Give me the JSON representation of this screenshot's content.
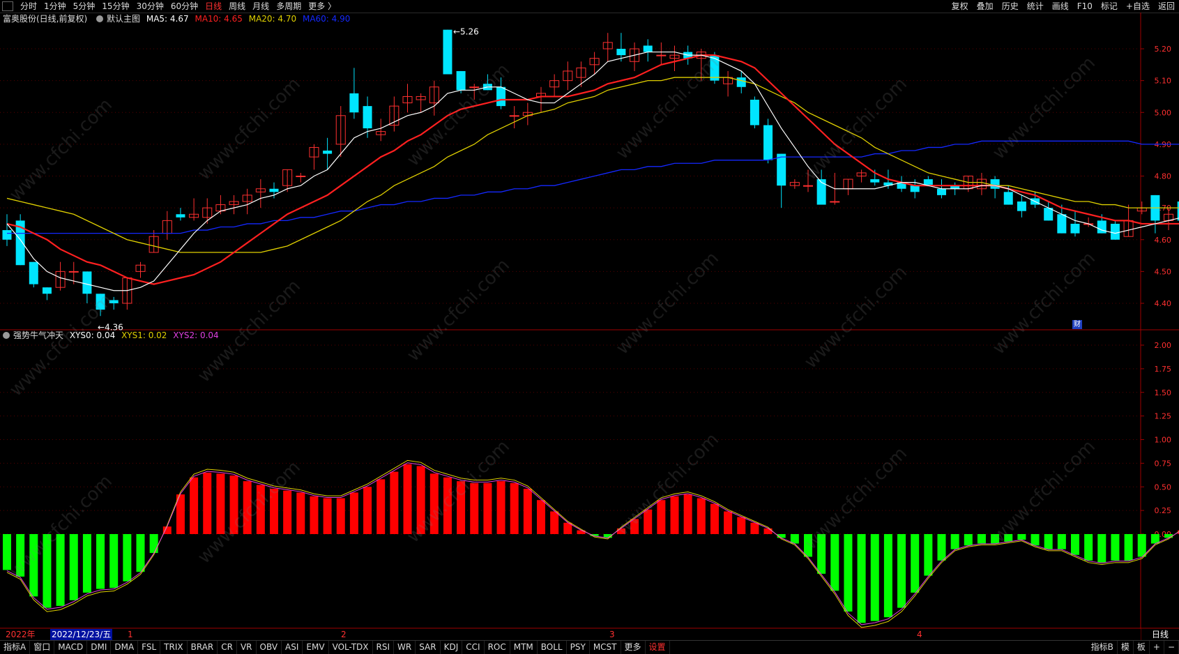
{
  "topbar": {
    "tabs": [
      "分时",
      "1分钟",
      "5分钟",
      "15分钟",
      "30分钟",
      "60分钟",
      "日线",
      "周线",
      "月线",
      "多周期",
      "更多 〉"
    ],
    "active_tab": "日线",
    "right_tools": [
      "复权",
      "叠加",
      "历史",
      "统计",
      "画线",
      "F10",
      "标记",
      "+自选",
      "返回"
    ]
  },
  "main_legend": {
    "stock": "富奥股份(日线,前复权)",
    "template": "默认主图",
    "ma5": "MA5: 4.67",
    "ma10": "MA10: 4.65",
    "ma20": "MA20: 4.70",
    "ma60": "MA60: 4.90"
  },
  "indicator_legend": {
    "name": "强势牛气冲天",
    "xys0": "XYS0: 0.04",
    "xys1": "XYS1: 0.02",
    "xys2": "XYS2: 0.04"
  },
  "annotations": {
    "high": "5.26",
    "low": "←4.36",
    "cai": "财"
  },
  "date_axis": {
    "year": "2022年",
    "cursor_date": "2022/12/23/五",
    "months": [
      "1",
      "2",
      "3",
      "4"
    ]
  },
  "right_label": "日线",
  "bottombar": {
    "left": [
      "指标A",
      "窗口",
      "MACD",
      "DMI",
      "DMA",
      "FSL",
      "TRIX",
      "BRAR",
      "CR",
      "VR",
      "OBV",
      "ASI",
      "EMV",
      "VOL-TDX",
      "RSI",
      "WR",
      "SAR",
      "KDJ",
      "CCI",
      "ROC",
      "MTM",
      "BOLL",
      "PSY",
      "MCST",
      "更多",
      "设置"
    ],
    "active": "设置",
    "right": [
      "指标B",
      "模",
      "板",
      "+",
      "−"
    ]
  },
  "watermark": "www.cfchi.com",
  "colors": {
    "up": "#ff3030",
    "down": "#00e5ff",
    "ma5": "#ffffff",
    "ma10": "#ff2020",
    "ma20": "#e0d000",
    "ma60": "#1428ff",
    "bar_up": "#ff0000",
    "bar_down": "#00ff00"
  },
  "chart_data": [
    {
      "type": "candlestick",
      "yticks": [
        "5.20",
        "5.10",
        "5.00",
        "4.90",
        "4.80",
        "4.70",
        "4.60",
        "4.50",
        "4.40"
      ],
      "ohlc": [
        [
          4.63,
          4.68,
          4.58,
          4.6
        ],
        [
          4.66,
          4.68,
          4.52,
          4.52
        ],
        [
          4.53,
          4.53,
          4.45,
          4.46
        ],
        [
          4.45,
          4.45,
          4.41,
          4.43
        ],
        [
          4.45,
          4.53,
          4.44,
          4.5
        ],
        [
          4.5,
          4.53,
          4.46,
          4.5
        ],
        [
          4.5,
          4.5,
          4.4,
          4.43
        ],
        [
          4.43,
          4.43,
          4.36,
          4.38
        ],
        [
          4.41,
          4.42,
          4.38,
          4.4
        ],
        [
          4.4,
          4.48,
          4.38,
          4.48
        ],
        [
          4.5,
          4.53,
          4.48,
          4.52
        ],
        [
          4.56,
          4.63,
          4.56,
          4.61
        ],
        [
          4.62,
          4.69,
          4.6,
          4.66
        ],
        [
          4.68,
          4.7,
          4.66,
          4.67
        ],
        [
          4.67,
          4.73,
          4.66,
          4.68
        ],
        [
          4.67,
          4.73,
          4.65,
          4.7
        ],
        [
          4.69,
          4.74,
          4.68,
          4.71
        ],
        [
          4.71,
          4.74,
          4.68,
          4.72
        ],
        [
          4.72,
          4.76,
          4.68,
          4.74
        ],
        [
          4.75,
          4.79,
          4.7,
          4.76
        ],
        [
          4.76,
          4.78,
          4.73,
          4.75
        ],
        [
          4.77,
          4.82,
          4.75,
          4.82
        ],
        [
          4.8,
          4.81,
          4.78,
          4.8
        ],
        [
          4.86,
          4.9,
          4.82,
          4.89
        ],
        [
          4.88,
          4.92,
          4.82,
          4.87
        ],
        [
          4.9,
          5.02,
          4.86,
          4.99
        ],
        [
          5.06,
          5.14,
          4.98,
          5.0
        ],
        [
          5.02,
          5.05,
          4.92,
          4.95
        ],
        [
          4.93,
          4.98,
          4.91,
          4.94
        ],
        [
          4.96,
          5.05,
          4.94,
          5.02
        ],
        [
          5.03,
          5.09,
          5.0,
          5.05
        ],
        [
          5.04,
          5.06,
          5.0,
          5.05
        ],
        [
          5.03,
          5.1,
          4.99,
          5.08
        ],
        [
          5.26,
          5.26,
          5.12,
          5.12
        ],
        [
          5.13,
          5.13,
          5.06,
          5.07
        ],
        [
          5.08,
          5.09,
          5.04,
          5.08
        ],
        [
          5.09,
          5.12,
          5.07,
          5.07
        ],
        [
          5.08,
          5.11,
          5.01,
          5.02
        ],
        [
          4.99,
          5.02,
          4.95,
          4.99
        ],
        [
          4.99,
          5.03,
          4.96,
          5.0
        ],
        [
          5.05,
          5.08,
          5.0,
          5.06
        ],
        [
          5.08,
          5.12,
          5.05,
          5.1
        ],
        [
          5.1,
          5.16,
          5.07,
          5.13
        ],
        [
          5.11,
          5.16,
          5.08,
          5.14
        ],
        [
          5.15,
          5.19,
          5.12,
          5.17
        ],
        [
          5.2,
          5.25,
          5.16,
          5.22
        ],
        [
          5.2,
          5.25,
          5.16,
          5.18
        ],
        [
          5.16,
          5.22,
          5.13,
          5.2
        ],
        [
          5.21,
          5.23,
          5.16,
          5.19
        ],
        [
          5.18,
          5.22,
          5.15,
          5.18
        ],
        [
          5.17,
          5.21,
          5.13,
          5.18
        ],
        [
          5.19,
          5.21,
          5.15,
          5.17
        ],
        [
          5.17,
          5.2,
          5.1,
          5.19
        ],
        [
          5.18,
          5.19,
          5.09,
          5.1
        ],
        [
          5.09,
          5.13,
          5.05,
          5.11
        ],
        [
          5.11,
          5.13,
          5.06,
          5.08
        ],
        [
          5.04,
          5.05,
          4.95,
          4.96
        ],
        [
          4.96,
          4.98,
          4.84,
          4.85
        ],
        [
          4.87,
          4.87,
          4.7,
          4.77
        ],
        [
          4.77,
          4.79,
          4.76,
          4.78
        ],
        [
          4.77,
          4.82,
          4.75,
          4.77
        ],
        [
          4.79,
          4.82,
          4.72,
          4.71
        ],
        [
          4.72,
          4.81,
          4.71,
          4.72
        ],
        [
          4.76,
          4.79,
          4.74,
          4.79
        ],
        [
          4.8,
          4.82,
          4.78,
          4.81
        ],
        [
          4.79,
          4.82,
          4.77,
          4.78
        ],
        [
          4.78,
          4.82,
          4.76,
          4.77
        ],
        [
          4.78,
          4.8,
          4.75,
          4.76
        ],
        [
          4.77,
          4.79,
          4.73,
          4.75
        ],
        [
          4.79,
          4.8,
          4.77,
          4.77
        ],
        [
          4.76,
          4.79,
          4.73,
          4.74
        ],
        [
          4.77,
          4.78,
          4.74,
          4.76
        ],
        [
          4.76,
          4.8,
          4.75,
          4.8
        ],
        [
          4.76,
          4.81,
          4.74,
          4.79
        ],
        [
          4.79,
          4.8,
          4.73,
          4.76
        ],
        [
          4.75,
          4.77,
          4.71,
          4.71
        ],
        [
          4.72,
          4.74,
          4.67,
          4.69
        ],
        [
          4.73,
          4.75,
          4.7,
          4.71
        ],
        [
          4.7,
          4.72,
          4.66,
          4.66
        ],
        [
          4.68,
          4.71,
          4.62,
          4.62
        ],
        [
          4.65,
          4.69,
          4.61,
          4.62
        ],
        [
          4.65,
          4.67,
          4.64,
          4.65
        ],
        [
          4.66,
          4.68,
          4.62,
          4.62
        ],
        [
          4.65,
          4.66,
          4.6,
          4.6
        ],
        [
          4.61,
          4.71,
          4.61,
          4.66
        ],
        [
          4.69,
          4.72,
          4.68,
          4.7
        ],
        [
          4.74,
          4.74,
          4.62,
          4.66
        ],
        [
          4.66,
          4.7,
          4.63,
          4.68
        ],
        [
          4.72,
          4.78,
          4.66,
          4.66
        ]
      ],
      "ma5": [
        4.65,
        4.6,
        4.54,
        4.5,
        4.48,
        4.47,
        4.46,
        4.45,
        4.44,
        4.44,
        4.45,
        4.47,
        4.52,
        4.57,
        4.62,
        4.66,
        4.69,
        4.7,
        4.71,
        4.73,
        4.74,
        4.76,
        4.77,
        4.8,
        4.82,
        4.87,
        4.92,
        4.94,
        4.95,
        4.97,
        4.99,
        5.0,
        5.02,
        5.06,
        5.07,
        5.07,
        5.08,
        5.08,
        5.06,
        5.04,
        5.03,
        5.03,
        5.06,
        5.09,
        5.12,
        5.16,
        5.17,
        5.18,
        5.19,
        5.19,
        5.19,
        5.18,
        5.18,
        5.17,
        5.15,
        5.13,
        5.09,
        5.02,
        4.95,
        4.89,
        4.83,
        4.78,
        4.76,
        4.76,
        4.76,
        4.76,
        4.77,
        4.78,
        4.78,
        4.77,
        4.76,
        4.76,
        4.76,
        4.77,
        4.77,
        4.76,
        4.74,
        4.72,
        4.7,
        4.68,
        4.66,
        4.65,
        4.63,
        4.62,
        4.63,
        4.64,
        4.65,
        4.66,
        4.67
      ],
      "ma10": [
        4.65,
        4.64,
        4.62,
        4.6,
        4.57,
        4.55,
        4.53,
        4.52,
        4.5,
        4.48,
        4.47,
        4.46,
        4.47,
        4.48,
        4.49,
        4.51,
        4.53,
        4.56,
        4.59,
        4.62,
        4.65,
        4.68,
        4.7,
        4.72,
        4.74,
        4.77,
        4.8,
        4.83,
        4.86,
        4.88,
        4.91,
        4.93,
        4.96,
        4.99,
        5.01,
        5.02,
        5.03,
        5.04,
        5.04,
        5.04,
        5.05,
        5.05,
        5.05,
        5.06,
        5.07,
        5.09,
        5.1,
        5.11,
        5.13,
        5.15,
        5.16,
        5.17,
        5.18,
        5.18,
        5.17,
        5.16,
        5.14,
        5.1,
        5.06,
        5.02,
        4.98,
        4.94,
        4.9,
        4.87,
        4.84,
        4.81,
        4.79,
        4.78,
        4.77,
        4.77,
        4.77,
        4.77,
        4.77,
        4.77,
        4.77,
        4.76,
        4.75,
        4.74,
        4.72,
        4.7,
        4.69,
        4.68,
        4.67,
        4.66,
        4.66,
        4.65,
        4.65,
        4.65,
        4.65
      ],
      "ma20": [
        4.73,
        4.72,
        4.71,
        4.7,
        4.69,
        4.68,
        4.66,
        4.64,
        4.62,
        4.6,
        4.59,
        4.58,
        4.57,
        4.56,
        4.56,
        4.56,
        4.56,
        4.56,
        4.56,
        4.56,
        4.57,
        4.58,
        4.6,
        4.62,
        4.64,
        4.66,
        4.69,
        4.72,
        4.74,
        4.77,
        4.79,
        4.81,
        4.83,
        4.86,
        4.88,
        4.9,
        4.93,
        4.95,
        4.97,
        4.99,
        5.0,
        5.01,
        5.03,
        5.04,
        5.05,
        5.07,
        5.08,
        5.09,
        5.1,
        5.1,
        5.11,
        5.11,
        5.11,
        5.11,
        5.11,
        5.1,
        5.09,
        5.07,
        5.05,
        5.03,
        5.0,
        4.98,
        4.96,
        4.94,
        4.92,
        4.89,
        4.87,
        4.85,
        4.83,
        4.81,
        4.8,
        4.79,
        4.78,
        4.78,
        4.77,
        4.77,
        4.76,
        4.75,
        4.74,
        4.73,
        4.72,
        4.72,
        4.71,
        4.71,
        4.7,
        4.7,
        4.7,
        4.7,
        4.7
      ],
      "ma60": [
        4.62,
        4.62,
        4.62,
        4.62,
        4.62,
        4.62,
        4.62,
        4.62,
        4.62,
        4.62,
        4.62,
        4.62,
        4.62,
        4.62,
        4.63,
        4.63,
        4.64,
        4.64,
        4.65,
        4.65,
        4.66,
        4.66,
        4.67,
        4.67,
        4.68,
        4.69,
        4.69,
        4.7,
        4.71,
        4.71,
        4.72,
        4.72,
        4.73,
        4.73,
        4.74,
        4.74,
        4.75,
        4.75,
        4.76,
        4.76,
        4.77,
        4.77,
        4.78,
        4.79,
        4.8,
        4.81,
        4.82,
        4.82,
        4.83,
        4.83,
        4.84,
        4.84,
        4.84,
        4.85,
        4.85,
        4.85,
        4.85,
        4.85,
        4.86,
        4.86,
        4.86,
        4.86,
        4.86,
        4.86,
        4.86,
        4.87,
        4.87,
        4.88,
        4.88,
        4.89,
        4.89,
        4.9,
        4.9,
        4.91,
        4.91,
        4.91,
        4.91,
        4.91,
        4.91,
        4.91,
        4.91,
        4.91,
        4.91,
        4.91,
        4.91,
        4.9,
        4.9,
        4.9,
        4.9
      ]
    },
    {
      "type": "bar",
      "yticks": [
        "2.00",
        "1.75",
        "1.50",
        "1.25",
        "1.00",
        "0.75",
        "0.50",
        "0.25",
        "0.00"
      ],
      "values": [
        -0.38,
        -0.45,
        -0.66,
        -0.78,
        -0.76,
        -0.7,
        -0.62,
        -0.58,
        -0.57,
        -0.5,
        -0.4,
        -0.2,
        0.08,
        0.42,
        0.6,
        0.65,
        0.64,
        0.62,
        0.56,
        0.52,
        0.48,
        0.46,
        0.44,
        0.4,
        0.38,
        0.38,
        0.44,
        0.5,
        0.58,
        0.66,
        0.74,
        0.72,
        0.64,
        0.6,
        0.56,
        0.54,
        0.54,
        0.56,
        0.54,
        0.48,
        0.36,
        0.24,
        0.12,
        0.04,
        -0.02,
        -0.04,
        0.06,
        0.16,
        0.26,
        0.36,
        0.4,
        0.42,
        0.38,
        0.32,
        0.24,
        0.18,
        0.12,
        0.06,
        -0.04,
        -0.1,
        -0.24,
        -0.42,
        -0.6,
        -0.82,
        -0.94,
        -0.92,
        -0.88,
        -0.78,
        -0.62,
        -0.44,
        -0.28,
        -0.16,
        -0.12,
        -0.1,
        -0.1,
        -0.08,
        -0.06,
        -0.12,
        -0.16,
        -0.16,
        -0.22,
        -0.28,
        -0.3,
        -0.28,
        -0.28,
        -0.24,
        -0.1,
        -0.04,
        0.04
      ]
    }
  ]
}
